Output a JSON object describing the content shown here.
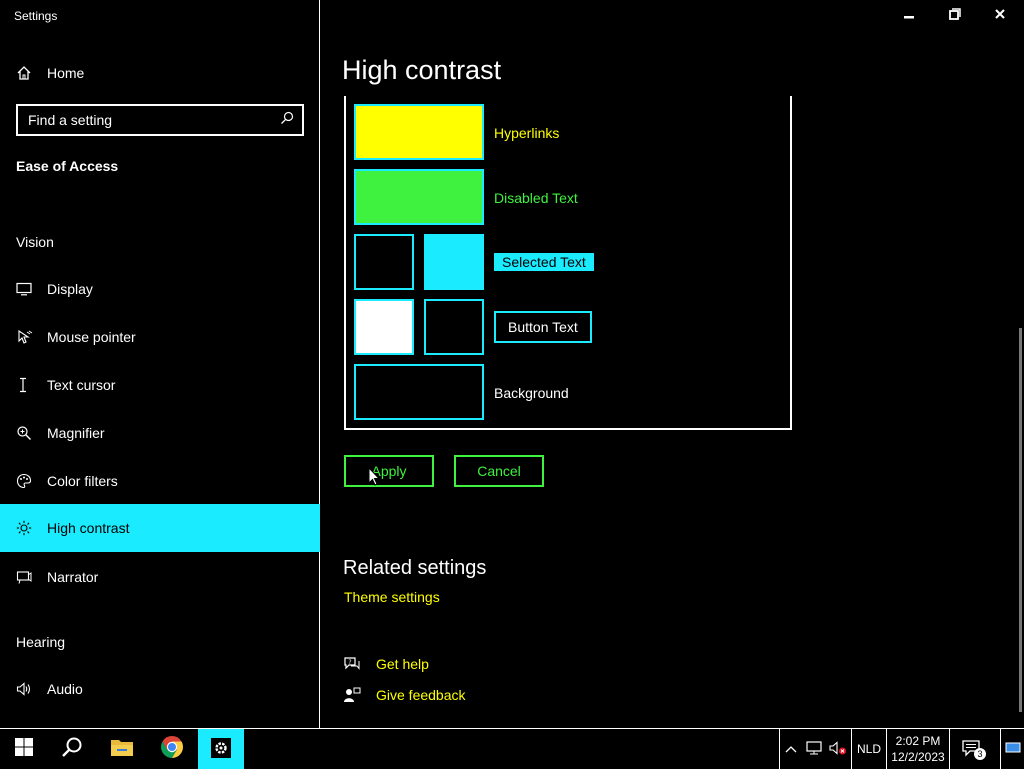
{
  "window": {
    "title": "Settings",
    "minimize_icon": "minimize-icon",
    "maximize_icon": "restore-icon",
    "close_icon": "close-icon"
  },
  "sidebar": {
    "home_label": "Home",
    "search": {
      "placeholder": "Find a setting"
    },
    "category": "Ease of Access",
    "vision_header": "Vision",
    "vision_items": [
      {
        "label": "Display",
        "icon": "monitor-icon"
      },
      {
        "label": "Mouse pointer",
        "icon": "mouse-pointer-icon"
      },
      {
        "label": "Text cursor",
        "icon": "text-cursor-icon"
      },
      {
        "label": "Magnifier",
        "icon": "magnifier-icon"
      },
      {
        "label": "Color filters",
        "icon": "palette-icon"
      },
      {
        "label": "High contrast",
        "icon": "brightness-icon",
        "selected": true
      },
      {
        "label": "Narrator",
        "icon": "narrator-icon"
      }
    ],
    "hearing_header": "Hearing",
    "hearing_items": [
      {
        "label": "Audio",
        "icon": "speaker-icon"
      }
    ]
  },
  "main": {
    "title": "High contrast",
    "colors": {
      "hyperlinks": "#ffff00",
      "disabled_text": "#3ff23f",
      "selected_text_bg": "#1aebff",
      "selected_text_fg": "#000000",
      "button_text_bg": "#000000",
      "button_text_fg": "#ffffff",
      "background": "#000000",
      "swatch_border": "#1aebff"
    },
    "swatch_labels": {
      "hyperlinks": "Hyperlinks",
      "disabled_text": "Disabled Text",
      "selected_text": "Selected Text",
      "button_text": "Button Text",
      "background": "Background"
    },
    "apply_label": "Apply",
    "cancel_label": "Cancel",
    "related_header": "Related settings",
    "theme_settings": "Theme settings",
    "get_help": "Get help",
    "give_feedback": "Give feedback"
  },
  "taskbar": {
    "pinned": [
      "start-icon",
      "search-icon",
      "file-explorer-icon",
      "chrome-icon",
      "settings-icon"
    ],
    "language": "NLD",
    "time": "2:02 PM",
    "date": "12/2/2023",
    "notification_count": "3"
  }
}
